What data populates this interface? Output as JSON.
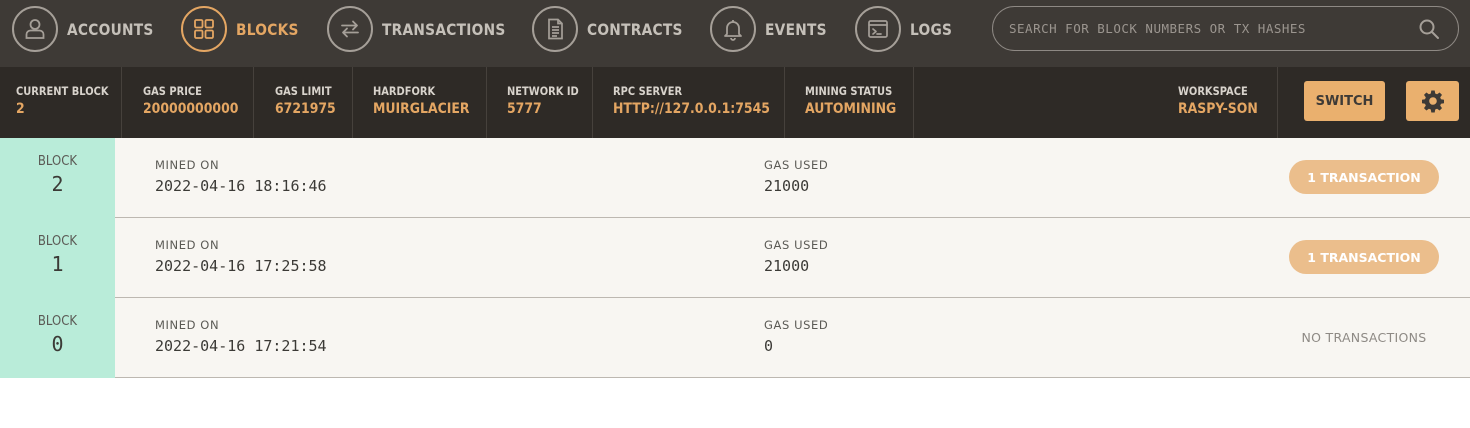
{
  "nav": {
    "items": [
      {
        "label": "ACCOUNTS",
        "icon": "user-icon",
        "active": false
      },
      {
        "label": "BLOCKS",
        "icon": "grid-icon",
        "active": true
      },
      {
        "label": "TRANSACTIONS",
        "icon": "transfer-arrows-icon",
        "active": false
      },
      {
        "label": "CONTRACTS",
        "icon": "document-icon",
        "active": false
      },
      {
        "label": "EVENTS",
        "icon": "bell-icon",
        "active": false
      },
      {
        "label": "LOGS",
        "icon": "terminal-icon",
        "active": false
      }
    ],
    "search_placeholder": "SEARCH FOR BLOCK NUMBERS OR TX HASHES"
  },
  "status": {
    "current_block_label": "CURRENT BLOCK",
    "current_block": "2",
    "gas_price_label": "GAS PRICE",
    "gas_price": "20000000000",
    "gas_limit_label": "GAS LIMIT",
    "gas_limit": "6721975",
    "hardfork_label": "HARDFORK",
    "hardfork": "MUIRGLACIER",
    "network_id_label": "NETWORK ID",
    "network_id": "5777",
    "rpc_server_label": "RPC SERVER",
    "rpc_server": "HTTP://127.0.0.1:7545",
    "mining_status_label": "MINING STATUS",
    "mining_status": "AUTOMINING",
    "workspace_label": "WORKSPACE",
    "workspace": "RASPY-SON",
    "switch_label": "SWITCH"
  },
  "blocks": [
    {
      "block_label": "BLOCK",
      "number": "2",
      "mined_on_label": "MINED ON",
      "mined_on": "2022-04-16 18:16:46",
      "gas_used_label": "GAS USED",
      "gas_used": "21000",
      "tx": "1 TRANSACTION",
      "has_tx": true
    },
    {
      "block_label": "BLOCK",
      "number": "1",
      "mined_on_label": "MINED ON",
      "mined_on": "2022-04-16 17:25:58",
      "gas_used_label": "GAS USED",
      "gas_used": "21000",
      "tx": "1 TRANSACTION",
      "has_tx": true
    },
    {
      "block_label": "BLOCK",
      "number": "0",
      "mined_on_label": "MINED ON",
      "mined_on": "2022-04-16 17:21:54",
      "gas_used_label": "GAS USED",
      "gas_used": "0",
      "tx": "NO TRANSACTIONS",
      "has_tx": false
    }
  ],
  "colors": {
    "nav_bg": "#3e3a36",
    "status_bg": "#2e2a26",
    "accent": "#e4a663",
    "block_number_bg": "#b9ecd9",
    "row_bg": "#f8f6f2"
  }
}
